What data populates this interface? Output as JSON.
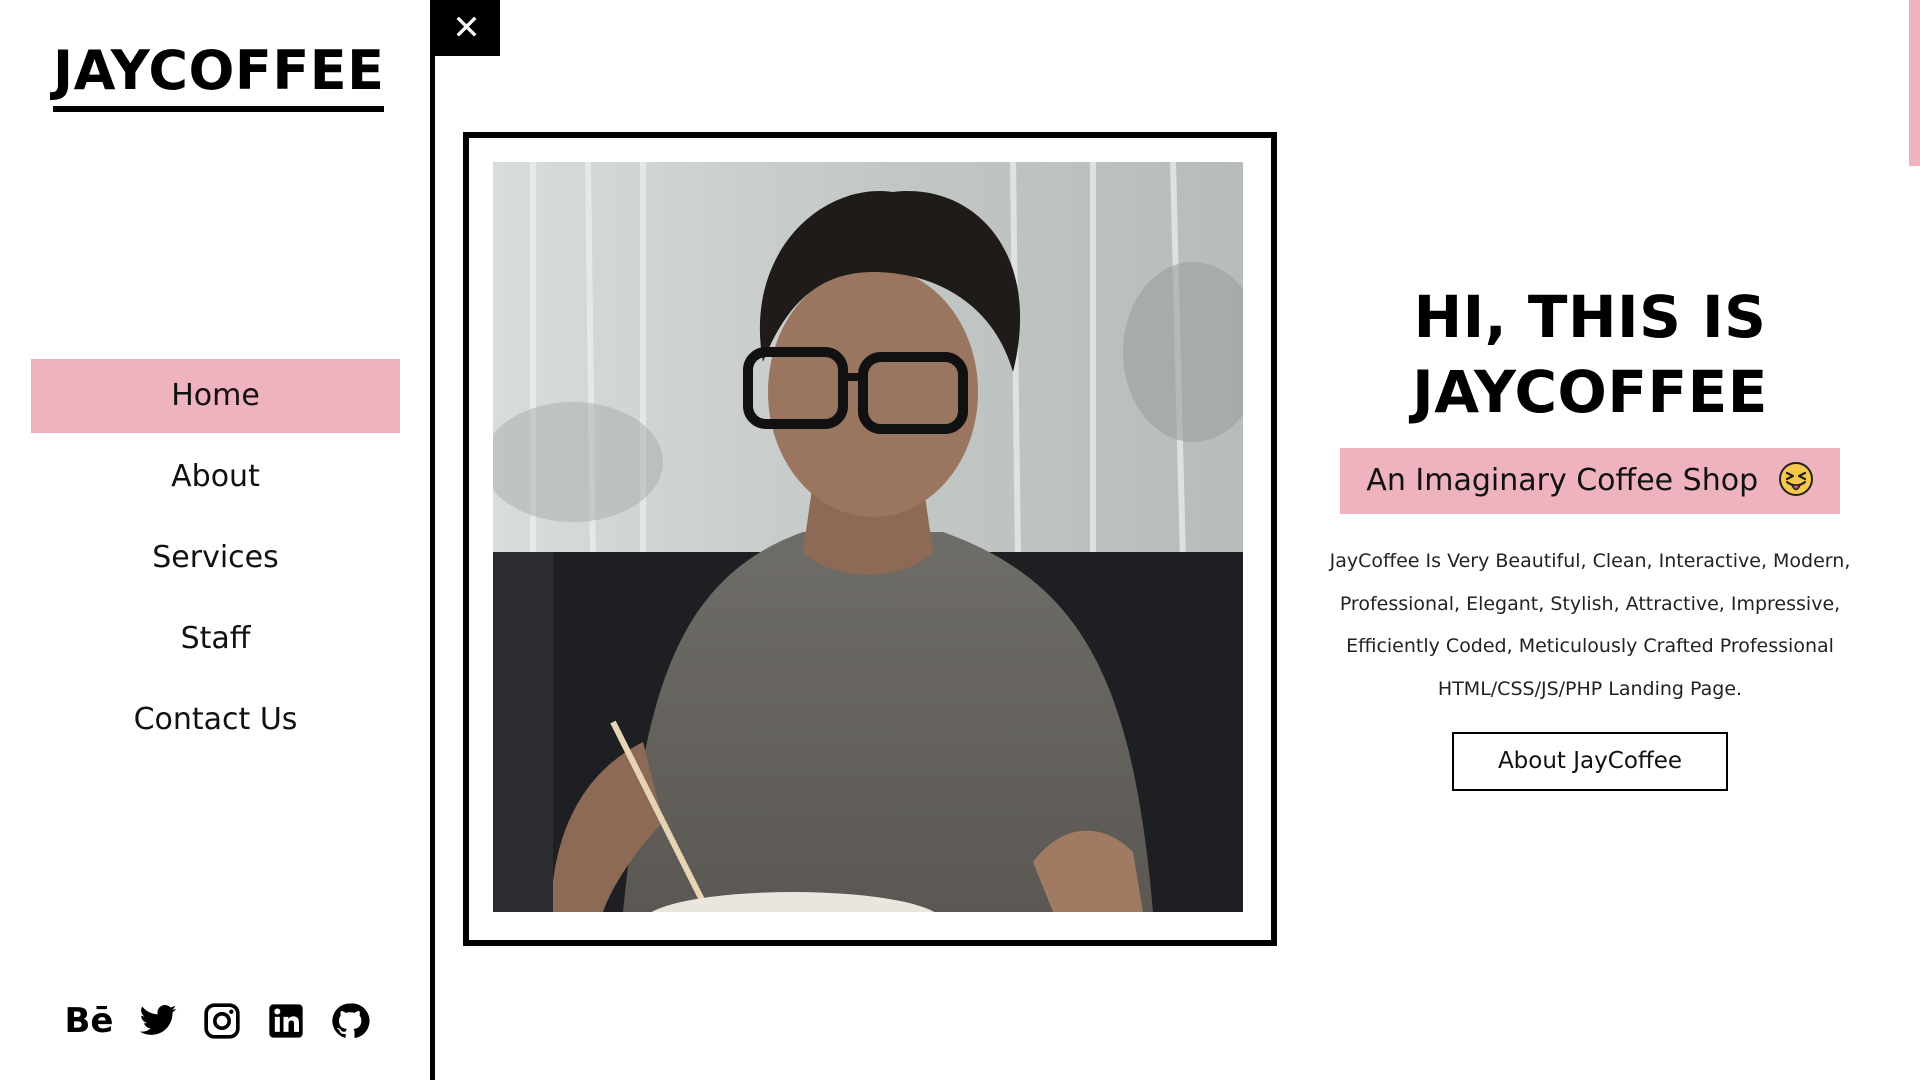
{
  "brand": {
    "logo": "JAYCOFFEE"
  },
  "nav": {
    "items": [
      {
        "label": "Home",
        "active": true
      },
      {
        "label": "About",
        "active": false
      },
      {
        "label": "Services",
        "active": false
      },
      {
        "label": "Staff",
        "active": false
      },
      {
        "label": "Contact Us",
        "active": false
      }
    ]
  },
  "socials": [
    {
      "icon": "behance-icon",
      "text": "Bē"
    },
    {
      "icon": "twitter-icon"
    },
    {
      "icon": "instagram-icon"
    },
    {
      "icon": "linkedin-icon"
    },
    {
      "icon": "github-icon"
    }
  ],
  "close": {
    "icon": "close-icon",
    "glyph": "✕"
  },
  "hero": {
    "title_line1": "HI, THIS IS",
    "title_line2": "JAYCOFFEE",
    "tagline": "An Imaginary Coffee Shop",
    "tagline_emoji": "squinting-face-with-tongue-icon",
    "description": [
      "JayCoffee Is Very Beautiful, Clean, Interactive, Modern,",
      "Professional, Elegant, Stylish, Attractive, Impressive,",
      "Efficiently Coded, Meticulously Crafted Professional",
      "HTML/CSS/JS/PHP Landing Page."
    ],
    "cta_label": "About JayCoffee"
  },
  "colors": {
    "accent": "#efb2bf",
    "text": "#000000",
    "background": "#ffffff"
  }
}
